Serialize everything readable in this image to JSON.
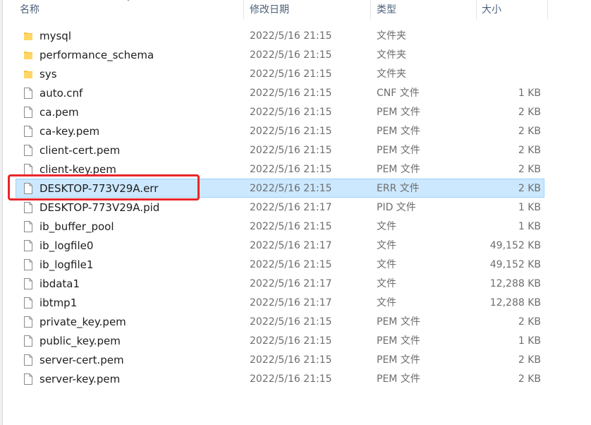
{
  "columns": {
    "name": "名称",
    "modified": "修改日期",
    "type": "类型",
    "size": "大小"
  },
  "colors": {
    "selection_bg": "#cce8ff",
    "selection_border": "#99d1ff",
    "highlight": "#e8262b",
    "folder": "#f8c33c"
  },
  "files": [
    {
      "name": "mysql",
      "modified": "2022/5/16 21:15",
      "type": "文件夹",
      "size": "",
      "icon": "folder-icon",
      "selected": false
    },
    {
      "name": "performance_schema",
      "modified": "2022/5/16 21:15",
      "type": "文件夹",
      "size": "",
      "icon": "folder-icon",
      "selected": false
    },
    {
      "name": "sys",
      "modified": "2022/5/16 21:15",
      "type": "文件夹",
      "size": "",
      "icon": "folder-icon",
      "selected": false
    },
    {
      "name": "auto.cnf",
      "modified": "2022/5/16 21:15",
      "type": "CNF 文件",
      "size": "1 KB",
      "icon": "file-icon",
      "selected": false
    },
    {
      "name": "ca.pem",
      "modified": "2022/5/16 21:15",
      "type": "PEM 文件",
      "size": "2 KB",
      "icon": "file-icon",
      "selected": false
    },
    {
      "name": "ca-key.pem",
      "modified": "2022/5/16 21:15",
      "type": "PEM 文件",
      "size": "2 KB",
      "icon": "file-icon",
      "selected": false
    },
    {
      "name": "client-cert.pem",
      "modified": "2022/5/16 21:15",
      "type": "PEM 文件",
      "size": "2 KB",
      "icon": "file-icon",
      "selected": false
    },
    {
      "name": "client-key.pem",
      "modified": "2022/5/16 21:15",
      "type": "PEM 文件",
      "size": "2 KB",
      "icon": "file-icon",
      "selected": false
    },
    {
      "name": "DESKTOP-773V29A.err",
      "modified": "2022/5/16 21:15",
      "type": "ERR 文件",
      "size": "2 KB",
      "icon": "file-icon",
      "selected": true
    },
    {
      "name": "DESKTOP-773V29A.pid",
      "modified": "2022/5/16 21:17",
      "type": "PID 文件",
      "size": "1 KB",
      "icon": "file-icon",
      "selected": false
    },
    {
      "name": "ib_buffer_pool",
      "modified": "2022/5/16 21:15",
      "type": "文件",
      "size": "1 KB",
      "icon": "file-icon",
      "selected": false
    },
    {
      "name": "ib_logfile0",
      "modified": "2022/5/16 21:17",
      "type": "文件",
      "size": "49,152 KB",
      "icon": "file-icon",
      "selected": false
    },
    {
      "name": "ib_logfile1",
      "modified": "2022/5/16 21:15",
      "type": "文件",
      "size": "49,152 KB",
      "icon": "file-icon",
      "selected": false
    },
    {
      "name": "ibdata1",
      "modified": "2022/5/16 21:17",
      "type": "文件",
      "size": "12,288 KB",
      "icon": "file-icon",
      "selected": false
    },
    {
      "name": "ibtmp1",
      "modified": "2022/5/16 21:17",
      "type": "文件",
      "size": "12,288 KB",
      "icon": "file-icon",
      "selected": false
    },
    {
      "name": "private_key.pem",
      "modified": "2022/5/16 21:15",
      "type": "PEM 文件",
      "size": "2 KB",
      "icon": "file-icon",
      "selected": false
    },
    {
      "name": "public_key.pem",
      "modified": "2022/5/16 21:15",
      "type": "PEM 文件",
      "size": "1 KB",
      "icon": "file-icon",
      "selected": false
    },
    {
      "name": "server-cert.pem",
      "modified": "2022/5/16 21:15",
      "type": "PEM 文件",
      "size": "2 KB",
      "icon": "file-icon",
      "selected": false
    },
    {
      "name": "server-key.pem",
      "modified": "2022/5/16 21:15",
      "type": "PEM 文件",
      "size": "2 KB",
      "icon": "file-icon",
      "selected": false
    }
  ]
}
